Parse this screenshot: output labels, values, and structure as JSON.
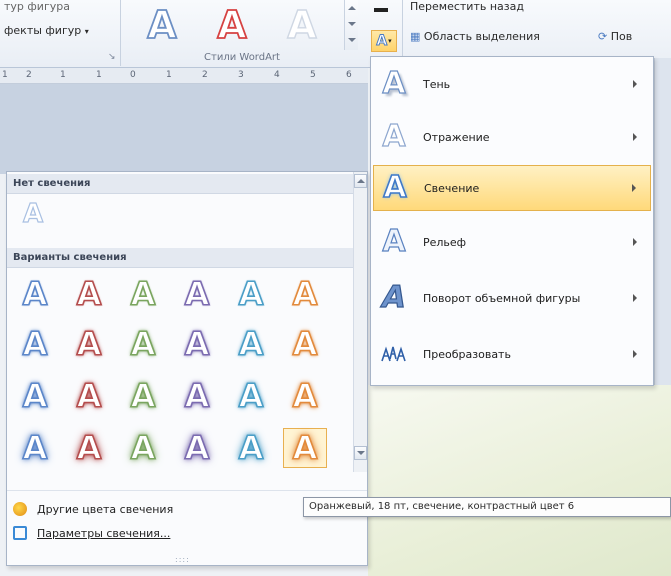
{
  "ribbon": {
    "shape_styles_text": "тур фигура",
    "shape_effects_label": "фекты фигур",
    "wordart_group_label": "Стили WordArt",
    "bring_back_label": "Переместить назад",
    "selection_pane_label": "Область выделения",
    "rotate_label": "Пов",
    "gallery_colors": [
      "#6c8fc4",
      "#d64242",
      "#cfd7e3"
    ]
  },
  "ruler": {
    "marks": [
      "1",
      "2",
      "1",
      "1",
      "0",
      "1",
      "2",
      "3",
      "4",
      "5",
      "6"
    ]
  },
  "glow_panel": {
    "no_glow_header": "Нет свечения",
    "variants_header": "Варианты свечения",
    "rows": [
      [
        "#5b86c9",
        "#b44d4d",
        "#7aa55f",
        "#7b6bb0",
        "#4a9ec7",
        "#e28a3c"
      ],
      [
        "#5b86c9",
        "#b44d4d",
        "#7aa55f",
        "#7b6bb0",
        "#4a9ec7",
        "#e28a3c"
      ],
      [
        "#5b86c9",
        "#b44d4d",
        "#7aa55f",
        "#7b6bb0",
        "#4a9ec7",
        "#e28a3c"
      ],
      [
        "#5b86c9",
        "#b44d4d",
        "#7aa55f",
        "#7b6bb0",
        "#4a9ec7",
        "#e28a3c"
      ]
    ],
    "glow_strengths": [
      2,
      4,
      6,
      9
    ],
    "selected": {
      "row": 3,
      "col": 5
    },
    "more_colors_label": "Другие цвета свечения",
    "options_label": "Параметры свечения...",
    "grip": "::::"
  },
  "effects_menu": {
    "items": [
      {
        "label": "Тень",
        "icon": "shadow-icon"
      },
      {
        "label": "Отражение",
        "icon": "reflection-icon"
      },
      {
        "label": "Свечение",
        "icon": "glow-icon",
        "active": true
      },
      {
        "label": "Рельеф",
        "icon": "bevel-icon"
      },
      {
        "label": "Поворот объемной фигуры",
        "icon": "3d-rotation-icon"
      },
      {
        "label": "Преобразовать",
        "icon": "transform-icon"
      }
    ]
  },
  "tooltip": {
    "text": "Оранжевый, 18 пт, свечение, контрастный цвет 6"
  },
  "colors": {
    "accent_highlight": "#ffd97a",
    "menu_border": "#a7b4c7"
  }
}
